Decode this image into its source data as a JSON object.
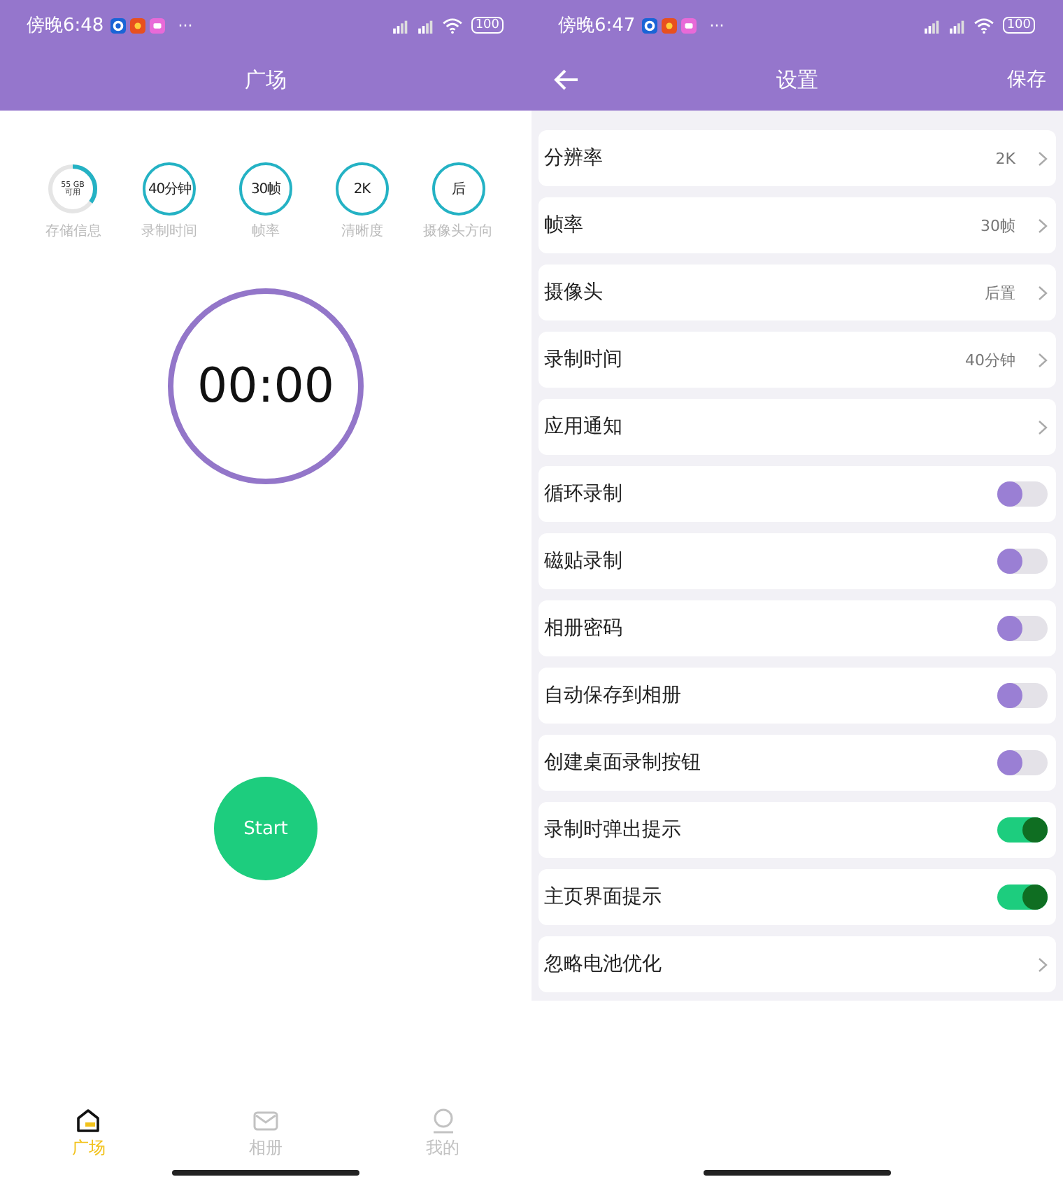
{
  "home_screen": {
    "status_bar": {
      "time": "傍晚6:48",
      "more": "···",
      "battery": "100"
    },
    "header": {
      "title": "广场"
    },
    "stats": [
      {
        "kind": "ring",
        "value": "55 GB可用",
        "label": "存储信息",
        "level": 0.35
      },
      {
        "kind": "circle",
        "value": "40分钟",
        "label": "录制时间"
      },
      {
        "kind": "circle",
        "value": "30帧",
        "label": "帧率"
      },
      {
        "kind": "circle",
        "value": "2K",
        "label": "清晰度"
      },
      {
        "kind": "circle",
        "value": "后",
        "label": "摄像头方向"
      }
    ],
    "timer": "00:00",
    "start_button": "Start",
    "nav": [
      {
        "kind": "home",
        "label": "广场",
        "selected": true
      },
      {
        "kind": "album",
        "label": "相册",
        "selected": false
      },
      {
        "kind": "profile",
        "label": "我的",
        "selected": false
      }
    ]
  },
  "settings_screen": {
    "status_bar": {
      "time": "傍晚6:47",
      "more": "···",
      "battery": "100"
    },
    "header": {
      "title": "设置",
      "action": "保存"
    },
    "rows": [
      {
        "kind": "link",
        "label": "分辨率",
        "value": "2K"
      },
      {
        "kind": "link",
        "label": "帧率",
        "value": "30帧"
      },
      {
        "kind": "link",
        "label": "摄像头",
        "value": "后置"
      },
      {
        "kind": "link",
        "label": "录制时间",
        "value": "40分钟"
      },
      {
        "kind": "link",
        "label": "应用通知"
      },
      {
        "kind": "toggle",
        "label": "循环录制",
        "on": false
      },
      {
        "kind": "toggle",
        "label": "磁贴录制",
        "on": false
      },
      {
        "kind": "toggle",
        "label": "相册密码",
        "on": false
      },
      {
        "kind": "toggle",
        "label": "自动保存到相册",
        "on": false
      },
      {
        "kind": "toggle",
        "label": "创建桌面录制按钮",
        "on": false
      },
      {
        "kind": "toggle",
        "label": "录制时弹出提示",
        "on": true
      },
      {
        "kind": "toggle",
        "label": "主页界面提示",
        "on": true
      },
      {
        "kind": "link",
        "label": "忽略电池优化"
      }
    ]
  }
}
